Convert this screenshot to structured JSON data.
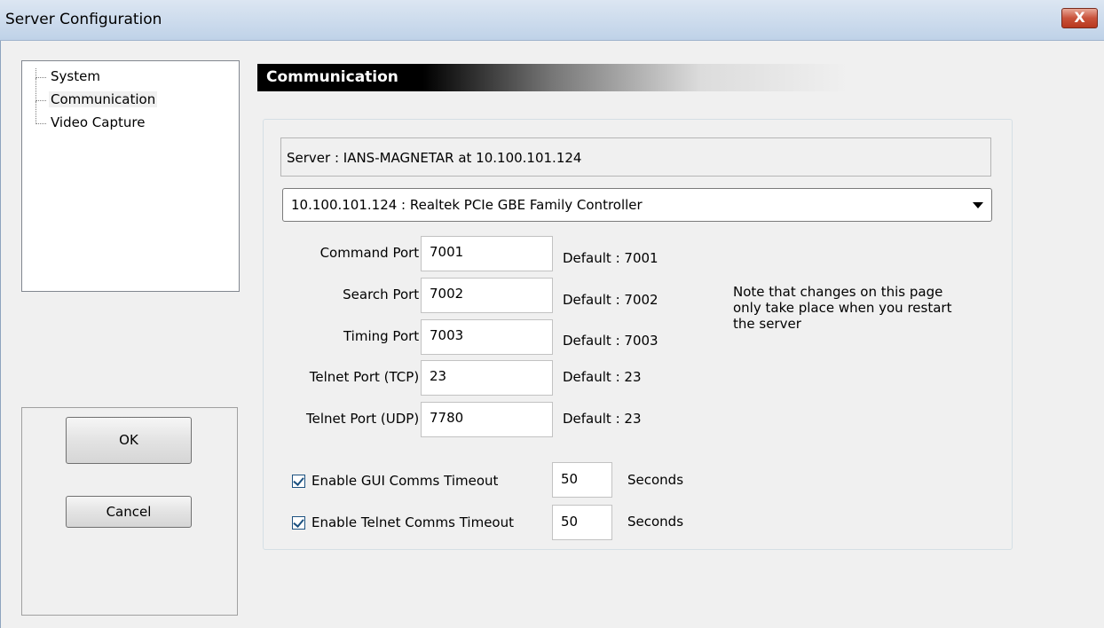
{
  "window": {
    "title": "Server Configuration",
    "close_glyph": "X",
    "close_icon": "close-icon"
  },
  "tree": {
    "items": [
      "System",
      "Communication",
      "Video Capture"
    ],
    "selected": "Communication"
  },
  "buttons": {
    "ok": "OK",
    "cancel": "Cancel"
  },
  "section": {
    "title": "Communication"
  },
  "server_info": "Server : IANS-MAGNETAR  at  10.100.101.124",
  "adapter": {
    "selected": "10.100.101.124 : Realtek PCIe GBE Family Controller"
  },
  "ports": [
    {
      "label": "Command Port :",
      "value": "7001",
      "default": "Default : 7001"
    },
    {
      "label": "Search Port :",
      "value": "7002",
      "default": "Default : 7002"
    },
    {
      "label": "Timing Port :",
      "value": "7003",
      "default": "Default : 7003"
    },
    {
      "label": "Telnet Port (TCP) :",
      "value": "23",
      "default": "Default : 23"
    },
    {
      "label": "Telnet Port (UDP) :",
      "value": "7780",
      "default": "Default : 23"
    }
  ],
  "note": "Note that changes on this page only take place when you restart the server",
  "timeouts": [
    {
      "label": "Enable GUI Comms Timeout",
      "checked": true,
      "value": "50",
      "unit": "Seconds"
    },
    {
      "label": "Enable Telnet Comms Timeout",
      "checked": true,
      "value": "50",
      "unit": "Seconds"
    }
  ],
  "colors": {
    "title_bar": "#bfd2e8",
    "close_button": "#c9523a",
    "header_bar": "#000000",
    "checkbox_border": "#1c5180"
  }
}
